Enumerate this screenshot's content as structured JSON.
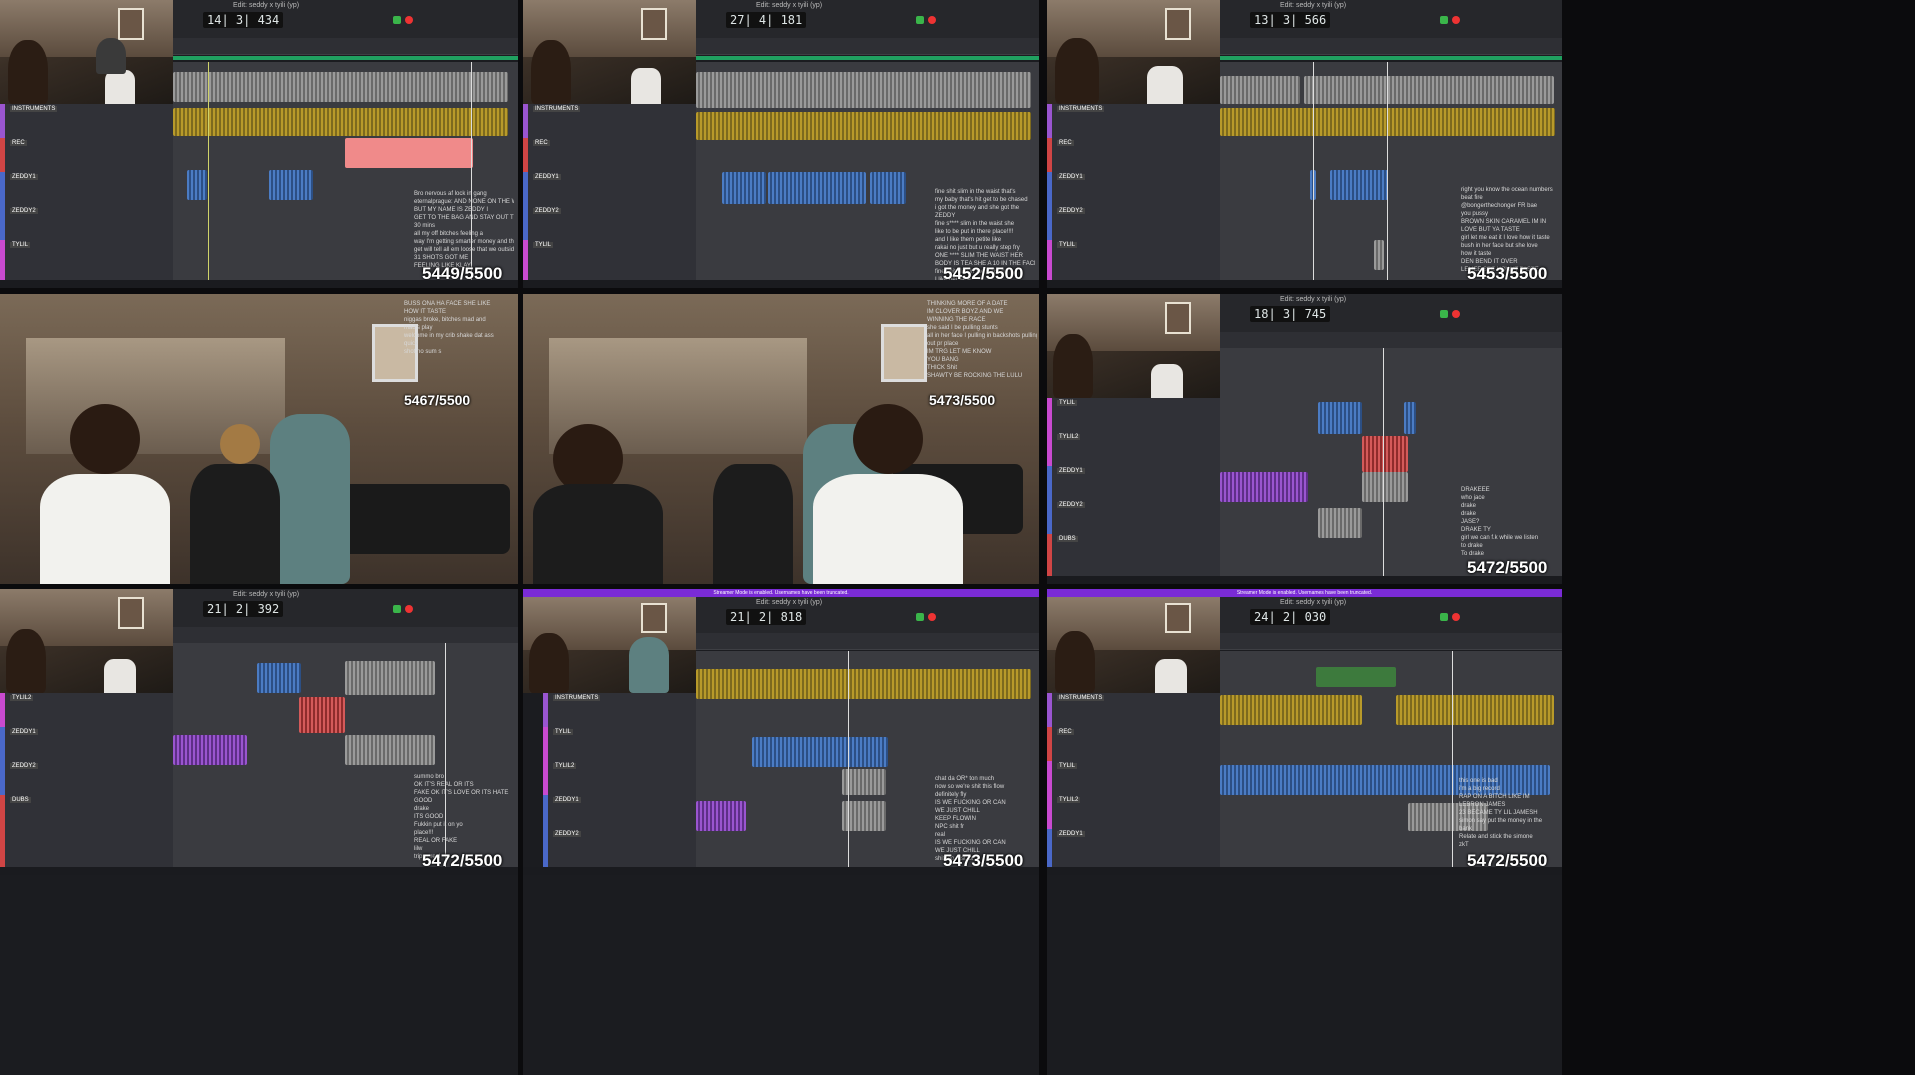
{
  "window_title": "Edit: seddy x tyili (yp)",
  "frames": {
    "f1": {
      "counter": "14| 3| 434",
      "count": "5449/5500"
    },
    "f2": {
      "counter": "27| 4| 181",
      "count": "5452/5500"
    },
    "f3": {
      "counter": "13| 3| 566",
      "count": "5453/5500"
    },
    "f4": {
      "count": "5467/5500"
    },
    "f5": {
      "count": "5473/5500"
    },
    "f6": {
      "counter": "18| 3| 745",
      "count": "5472/5500"
    },
    "f7": {
      "counter": "21| 2| 392",
      "count": "5472/5500"
    },
    "f8": {
      "counter": "21| 2| 818",
      "count": "5473/5500"
    },
    "f9": {
      "counter": "24| 2| 030",
      "count": "5472/5500"
    }
  },
  "tracks": {
    "instrument": "INSTRUMENTS",
    "rec": "REC",
    "zeddy1": "ZEDDY1",
    "zeddy2": "ZEDDY2",
    "tylil": "TYLIL",
    "tylil2": "TYLIL2",
    "dubs": "DUBS"
  },
  "chat": {
    "f1": [
      "Bro nervous af lock in gang",
      "eternalprague: AND NONE ON THE WAY",
      "BUT MY NAME IS ZEDDY I",
      "GET TO THE BAG AND STAY OUT THE WAY",
      "30 mins",
      "all my off bitches feeling a",
      "way I'm getting smarter money and they can't",
      "get will tell all em loose that we outside",
      "31 SHOTS GOT ME",
      "FEELING LIKE KLAY"
    ],
    "f2": [
      "fine shit slim in the waist that's",
      "my baby that's hit get to be chased",
      "i got the money and she got the",
      "ZEDDY",
      "fine s**** slim in the waist she",
      "like to be put in there place!!!!",
      "and I like them petite like",
      "rakai no just but u really step fry",
      "ONE **** SLIM THE WAIST HER",
      "BODY IS TEA SHE A 10 IN THE FACE",
      "fine shit slim in the waist n",
      "I like her face"
    ],
    "f3": [
      "right you know the ocean numbers",
      "beat fire",
      "@bongerthechonger FR bae",
      "you pussy",
      "BROWN SKIN CARAMEL IM IN",
      "LOVE BUT YA TASTE",
      "girl let me eat it I love how it taste",
      "bush in her face but she love",
      "how it taste",
      "DEN BEND IT OVER",
      "LEMEE SEE HOW IT TASTE"
    ],
    "f4": [
      "BUSS ONA HA FACE SHE LIKE",
      "HOW IT TASTE",
      "niggas broke, bitches mad and",
      "mad's play",
      "welcome in my crib shake dat ass",
      "quick",
      "shot no sum s"
    ],
    "f5": [
      "THINKING MORE OF A DATE",
      "IM CLOVER BOYZ AND WE",
      "WINNING THE RACE",
      "she said I be pulling stunts",
      "all in her face I pulling in backshots pulling",
      "out pr place",
      "IM TRG LET ME KNOW",
      "YOU BANG",
      "THICK Shit",
      "SHAWTY BE ROCKING THE LULU"
    ],
    "f6": [
      "DRAKEEE",
      "who jace",
      "drake",
      "drake",
      "JASE?",
      "DRAKE TY",
      "girl we can f.k while we listen",
      "to drake",
      "To drake"
    ],
    "f7": [
      "summo bro",
      "OK IT'S REAL OR ITS",
      "FAKE OK IT'S LOVE OR ITS HATE",
      "GOOD",
      "drake",
      "ITS GOOD",
      "Fukkin put it on yo",
      "place!!!",
      "REAL OR FAKE",
      "lilw",
      "trippy real"
    ],
    "f8": [
      "chat da OR* ton much",
      "now so we're shit this flow",
      "definitely fly",
      "IS WE FUCKING OR CAN",
      "WE JUST CHILL",
      "KEEP FLOWIN",
      "NPC shit fr",
      "real",
      "IS WE FUCKING OR CAN",
      "WE JUST CHILL",
      "shit too fast lol"
    ],
    "f9": [
      "this one is bad",
      "i'm a big record",
      "RAP ON A BITCH LIKE IM",
      "LEBRON JAMES",
      "23 BECAME TY LIL JAMESH",
      "simon say put the money in the",
      "bank",
      "Relate and stick the simone",
      "zkT"
    ]
  },
  "banner": "Streamer Mode is enabled. Usernames have been truncated."
}
